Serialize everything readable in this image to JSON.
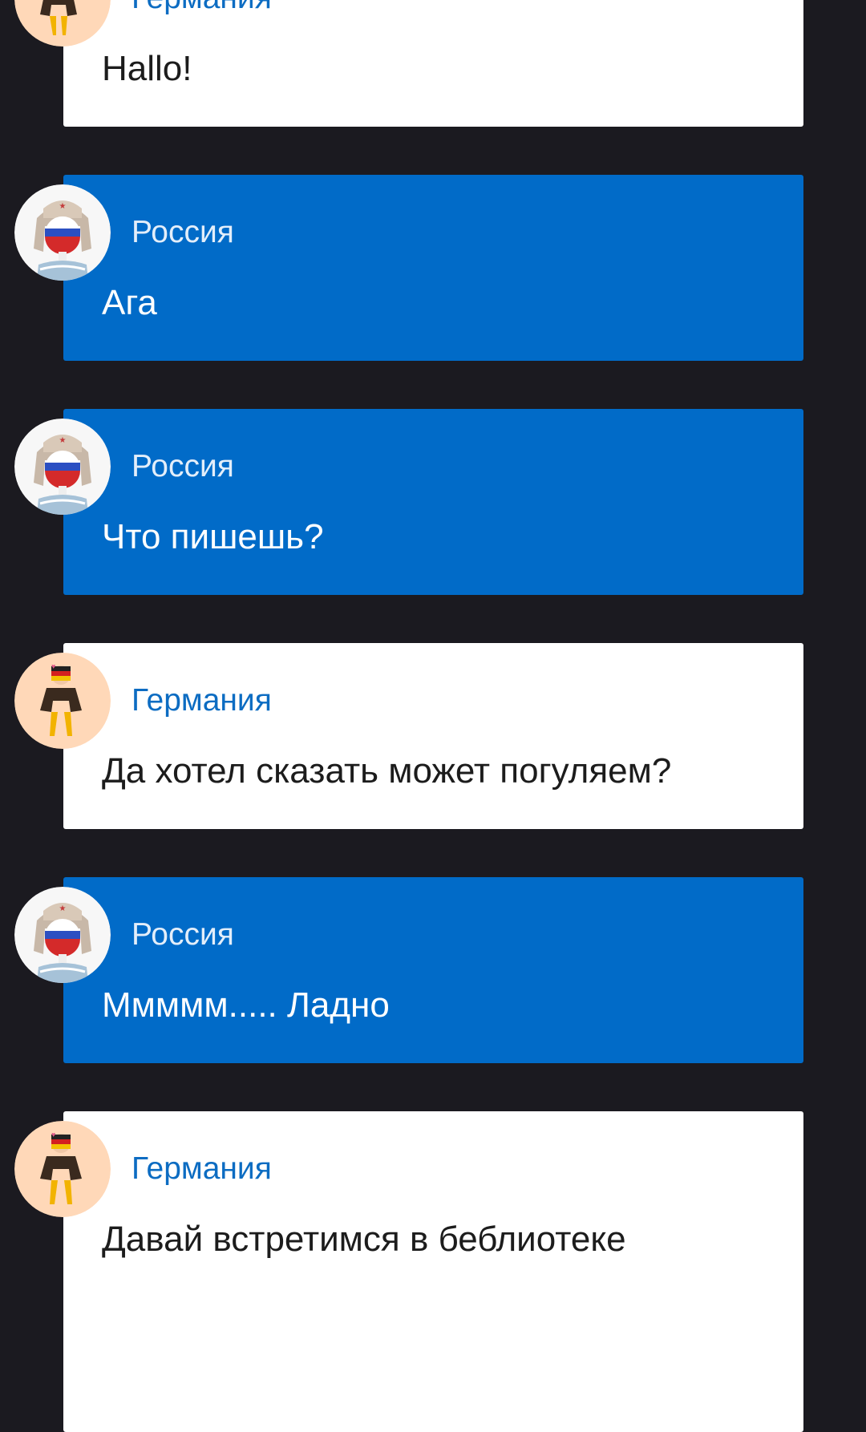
{
  "chat": {
    "messages": [
      {
        "sender": "Германия",
        "avatar": "germany-avatar",
        "theme": "white",
        "text": "Hallo!"
      },
      {
        "sender": "Россия",
        "avatar": "russia-avatar",
        "theme": "blue",
        "text": "Ага"
      },
      {
        "sender": "Россия",
        "avatar": "russia-avatar",
        "theme": "blue",
        "text": "Что пишешь?"
      },
      {
        "sender": "Германия",
        "avatar": "germany-avatar",
        "theme": "white",
        "text": "Да хотел сказать может погуляем?"
      },
      {
        "sender": "Россия",
        "avatar": "russia-avatar",
        "theme": "blue",
        "text": "Ммммм..... Ладно"
      },
      {
        "sender": "Германия",
        "avatar": "germany-avatar",
        "theme": "white",
        "text": "Давай встретимся в беблиотеке"
      }
    ]
  },
  "colors": {
    "background": "#1b1a20",
    "bubble_white": "#ffffff",
    "bubble_blue": "#016bc8",
    "name_on_white": "#0c6cc2",
    "name_on_blue": "#e3eefa"
  }
}
